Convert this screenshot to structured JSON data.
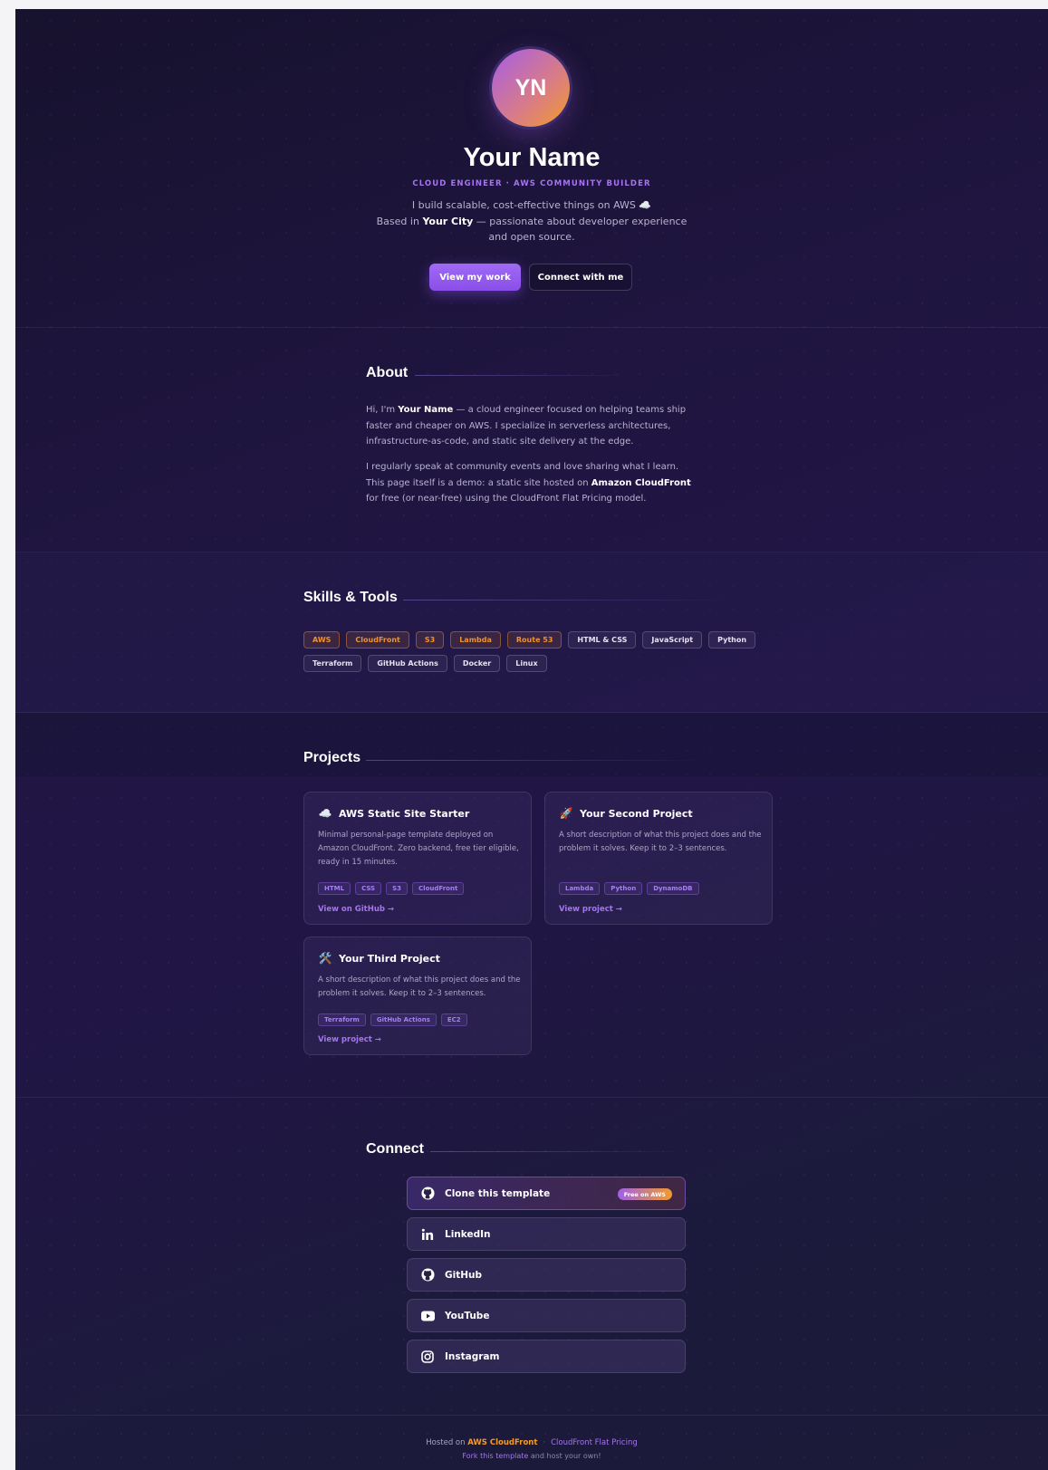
{
  "hero": {
    "initials": "YN",
    "name": "Your Name",
    "tagline": "CLOUD ENGINEER · AWS COMMUNITY BUILDER",
    "bio_line1": "I build scalable, cost-effective things on AWS ☁️",
    "bio_line2_prefix": "Based in ",
    "bio_city": "Your City",
    "bio_line2_suffix": " — passionate about developer experience and open source.",
    "primary_button": "View my work",
    "secondary_button": "Connect with me"
  },
  "about": {
    "title": "About",
    "p1_prefix": "Hi, I'm ",
    "p1_name": "Your Name",
    "p1_suffix": " — a cloud engineer focused on helping teams ship faster and cheaper on AWS. I specialize in serverless architectures, infrastructure-as-code, and static site delivery at the edge.",
    "p2_prefix": "I regularly speak at community events and love sharing what I learn. This page itself is a demo: a static site hosted on ",
    "p2_bold": "Amazon CloudFront",
    "p2_suffix": " for free (or near-free) using the CloudFront Flat Pricing model."
  },
  "skills": {
    "title": "Skills & Tools",
    "aws_chips": [
      "AWS",
      "CloudFront",
      "S3",
      "Lambda",
      "Route 53"
    ],
    "tool_chips": [
      "HTML & CSS",
      "JavaScript",
      "Python",
      "Terraform",
      "GitHub Actions",
      "Docker",
      "Linux"
    ]
  },
  "projects": {
    "title": "Projects",
    "items": [
      {
        "icon": "☁️",
        "title": "AWS Static Site Starter",
        "description": "Minimal personal-page template deployed on Amazon CloudFront. Zero backend, free tier eligible, ready in 15 minutes.",
        "tags": [
          "HTML",
          "CSS",
          "S3",
          "CloudFront"
        ],
        "link": "View on GitHub →"
      },
      {
        "icon": "🚀",
        "title": "Your Second Project",
        "description": "A short description of what this project does and the problem it solves. Keep it to 2–3 sentences.",
        "tags": [
          "Lambda",
          "Python",
          "DynamoDB"
        ],
        "link": "View project →"
      },
      {
        "icon": "🛠️",
        "title": "Your Third Project",
        "description": "A short description of what this project does and the problem it solves. Keep it to 2–3 sentences.",
        "tags": [
          "Terraform",
          "GitHub Actions",
          "EC2"
        ],
        "link": "View project →"
      }
    ]
  },
  "connect": {
    "title": "Connect",
    "links": [
      {
        "label": "Clone this template",
        "icon": "github-icon",
        "badge": "Free on AWS"
      },
      {
        "label": "LinkedIn",
        "icon": "linkedin-icon"
      },
      {
        "label": "GitHub",
        "icon": "github-icon"
      },
      {
        "label": "YouTube",
        "icon": "youtube-icon"
      },
      {
        "label": "Instagram",
        "icon": "instagram-icon"
      }
    ]
  },
  "footer": {
    "hosted_prefix": "Hosted on",
    "hosted_service": "AWS CloudFront",
    "pricing_link": "CloudFront Flat Pricing",
    "fork_link": "Fork this template",
    "fork_suffix": " and host your own!"
  },
  "colors": {
    "accent_purple": "#a574f0",
    "aws_orange": "#f39a2c",
    "background": "#1f1540"
  }
}
